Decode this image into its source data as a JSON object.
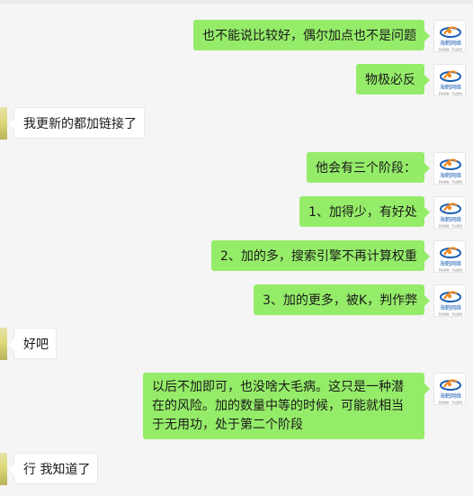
{
  "messages": [
    {
      "side": "me",
      "text": "也不能说比较好，偶尔加点也不是问题"
    },
    {
      "side": "me",
      "text": "物极必反"
    },
    {
      "side": "them",
      "text": "我更新的都加链接了"
    },
    {
      "side": "me",
      "text": "他会有三个阶段："
    },
    {
      "side": "me",
      "text": "1、加得少，有好处"
    },
    {
      "side": "me",
      "text": "2、加的多，搜索引擎不再计算权重"
    },
    {
      "side": "me",
      "text": "3、加的更多，被K，判作弊"
    },
    {
      "side": "them",
      "text": "好吧"
    },
    {
      "side": "me",
      "text": "以后不加即可，也没啥大毛病。这只是一种潜在的风险。加的数量中等的时候，可能就相当于无用功，处于第二个阶段"
    },
    {
      "side": "them",
      "text": "行 我知道了"
    }
  ],
  "avatars": {
    "me_logo_text": "海鹤网络",
    "me_logo_subtext": "值得信赖 · 专业服务",
    "them_icon": "sunflower-avatar"
  },
  "colors": {
    "background": "#f5f5f5",
    "my_bubble": "#95ec69",
    "their_bubble": "#ffffff",
    "logo_blue": "#1a5fb4",
    "logo_orange": "#f08a24"
  }
}
